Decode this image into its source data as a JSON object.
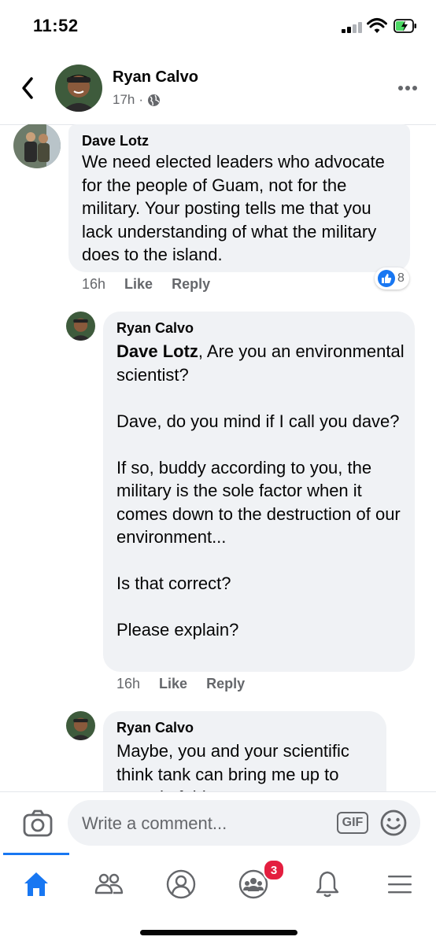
{
  "status_bar": {
    "time": "11:52",
    "signal_icon": "cellular-signal-icon",
    "wifi_icon": "wifi-icon",
    "battery_icon": "battery-charging-icon"
  },
  "header": {
    "author": "Ryan Calvo",
    "time_ago": "17h",
    "separator": "·",
    "privacy_icon": "globe-icon",
    "back_icon": "chevron-left-icon",
    "more_icon": "more-horizontal-icon"
  },
  "comments": [
    {
      "author": "Dave Lotz",
      "text": "We need elected leaders who advocate for the people of Guam, not for the military. Your posting tells me that you lack understanding of what the military does to the island.",
      "time": "16h",
      "like_label": "Like",
      "reply_label": "Reply",
      "reaction_count": "8"
    },
    {
      "author": "Ryan Calvo",
      "mention": "Dave Lotz",
      "text": ", Are you an environmental scientist?\n\nDave, do you mind if I call you dave?\n\nIf so, buddy according to you, the military is the sole factor when it comes down to the destruction of our environment...\n\nIs that correct?\n\nPlease explain?",
      "time": "16h",
      "like_label": "Like",
      "reply_label": "Reply"
    },
    {
      "author": "Ryan Calvo",
      "text": "Maybe, you and your scientific think tank can bring me up to speed of this matter..."
    }
  ],
  "composer": {
    "placeholder": "Write a comment...",
    "gif_label": "GIF",
    "camera_icon": "camera-icon",
    "emoji_icon": "emoji-icon"
  },
  "tabbar": {
    "tabs": [
      "home-icon",
      "friends-icon",
      "profile-icon",
      "groups-icon",
      "notifications-icon",
      "menu-icon"
    ],
    "groups_badge": "3",
    "active": "home",
    "accent": "#1877f2"
  }
}
